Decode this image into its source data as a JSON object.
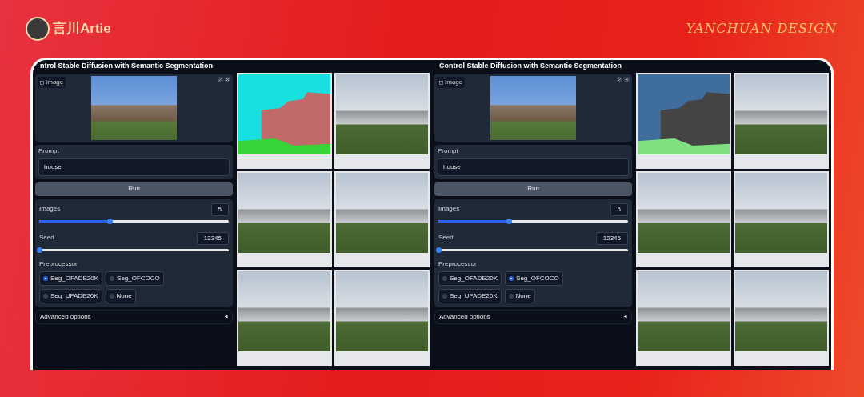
{
  "header": {
    "brand": "言川Artie",
    "signature": "YANCHUAN DESIGN"
  },
  "panels": [
    {
      "title": "ntrol Stable Diffusion with Semantic Segmentation",
      "image_label": "Image",
      "prompt_label": "Prompt",
      "prompt": "house",
      "run": "Run",
      "sliders": [
        {
          "label": "Images",
          "value": "5",
          "level": 0.37
        },
        {
          "label": "Seed",
          "value": "12345",
          "level": 0
        }
      ],
      "preprocessor_label": "Preprocessor",
      "options": [
        {
          "label": "Seg_OFADE20K",
          "selected": true
        },
        {
          "label": "Seg_OFCOCO",
          "selected": false
        },
        {
          "label": "Seg_UFADE20K",
          "selected": false
        },
        {
          "label": "None",
          "selected": false
        }
      ],
      "advanced": "Advanced options",
      "gallery": [
        {
          "kind": "segmentation"
        },
        {
          "kind": "photo"
        },
        {
          "kind": "photo"
        },
        {
          "kind": "photo"
        },
        {
          "kind": "photo"
        },
        {
          "kind": "photo"
        }
      ]
    },
    {
      "title": "Control Stable Diffusion with Semantic Segmentation",
      "image_label": "Image",
      "prompt_label": "Prompt",
      "prompt": "house",
      "run": "Run",
      "sliders": [
        {
          "label": "Images",
          "value": "5",
          "level": 0.37
        },
        {
          "label": "Seed",
          "value": "12345",
          "level": 0
        }
      ],
      "preprocessor_label": "Preprocessor",
      "options": [
        {
          "label": "Seg_OFADE20K",
          "selected": false
        },
        {
          "label": "Seg_OFCOCO",
          "selected": true
        },
        {
          "label": "Seg_UFADE20K",
          "selected": false
        },
        {
          "label": "None",
          "selected": false
        }
      ],
      "advanced": "Advanced options",
      "gallery": [
        {
          "kind": "segmentation"
        },
        {
          "kind": "photo"
        },
        {
          "kind": "photo"
        },
        {
          "kind": "photo"
        },
        {
          "kind": "photo"
        },
        {
          "kind": "photo"
        }
      ]
    }
  ]
}
